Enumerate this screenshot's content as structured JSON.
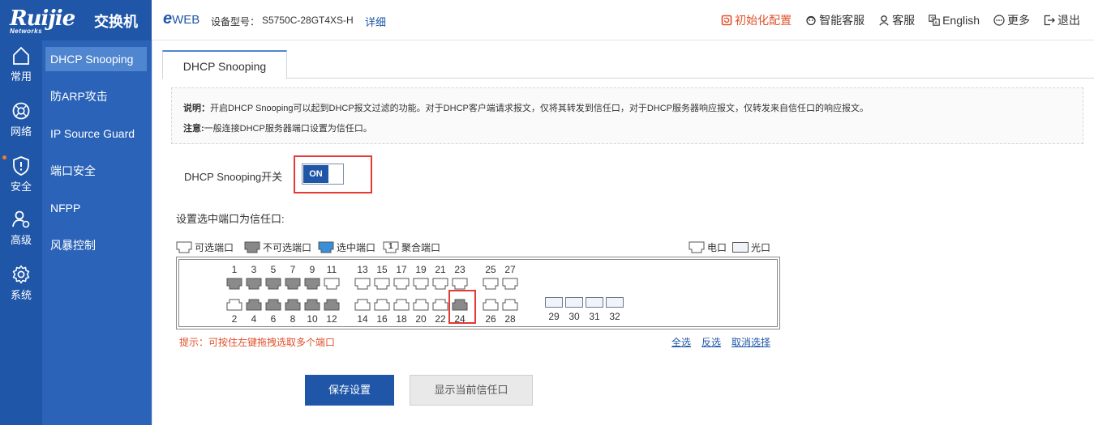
{
  "brand": {
    "logo": "Ruijie",
    "logo_sub": "Networks",
    "product": "交换机"
  },
  "topbar": {
    "eweb_e": "e",
    "eweb_rest": "WEB",
    "device_label": "设备型号：",
    "device_model": "S5750C-28GT4XS-H",
    "detail": "详细",
    "actions": [
      {
        "label": "初始化配置",
        "icon": "reset-icon",
        "color": "#e0502a"
      },
      {
        "label": "智能客服",
        "icon": "smart-service-icon"
      },
      {
        "label": "客服",
        "icon": "user-service-icon"
      },
      {
        "label": "English",
        "icon": "language-icon"
      },
      {
        "label": "更多",
        "icon": "more-icon"
      },
      {
        "label": "退出",
        "icon": "logout-icon"
      }
    ]
  },
  "sidebar": {
    "items": [
      {
        "label": "常用",
        "icon": "home-icon"
      },
      {
        "label": "网络",
        "icon": "globe-icon"
      },
      {
        "label": "安全",
        "icon": "shield-icon",
        "active": true
      },
      {
        "label": "高级",
        "icon": "advanced-user-icon"
      },
      {
        "label": "系统",
        "icon": "gear-icon"
      }
    ]
  },
  "submenu": {
    "items": [
      "DHCP Snooping",
      "防ARP攻击",
      "IP Source Guard",
      "端口安全",
      "NFPP",
      "风暴控制"
    ]
  },
  "tab": {
    "label": "DHCP Snooping"
  },
  "note": {
    "label1": "说明：",
    "text1": "开启DHCP Snooping可以起到DHCP报文过滤的功能。对于DHCP客户端请求报文，仅将其转发到信任口，对于DHCP服务器响应报文，仅转发来自信任口的响应报文。",
    "label2": "注意:",
    "text2": "一般连接DHCP服务器端口设置为信任口。"
  },
  "switch": {
    "label": "DHCP Snooping开关",
    "state": "ON"
  },
  "trust_label": "设置选中端口为信任口:",
  "legend": {
    "available": "可选端口",
    "unavailable": "不可选端口",
    "selected": "选中端口",
    "agg_num": "1",
    "aggregate": "聚合端口",
    "copper": "电口",
    "fiber": "光口"
  },
  "ports": {
    "top_row": [
      {
        "num": "1",
        "state": "unavailable"
      },
      {
        "num": "3",
        "state": "unavailable"
      },
      {
        "num": "5",
        "state": "unavailable"
      },
      {
        "num": "7",
        "state": "unavailable"
      },
      {
        "num": "9",
        "state": "unavailable"
      },
      {
        "num": "11",
        "state": "available"
      },
      {
        "num": "13",
        "state": "available"
      },
      {
        "num": "15",
        "state": "available"
      },
      {
        "num": "17",
        "state": "available"
      },
      {
        "num": "19",
        "state": "available"
      },
      {
        "num": "21",
        "state": "available"
      },
      {
        "num": "23",
        "state": "available"
      },
      {
        "num": "25",
        "state": "available"
      },
      {
        "num": "27",
        "state": "available"
      }
    ],
    "bottom_row": [
      {
        "num": "2",
        "state": "available"
      },
      {
        "num": "4",
        "state": "unavailable"
      },
      {
        "num": "6",
        "state": "unavailable"
      },
      {
        "num": "8",
        "state": "unavailable"
      },
      {
        "num": "10",
        "state": "unavailable"
      },
      {
        "num": "12",
        "state": "unavailable"
      },
      {
        "num": "14",
        "state": "available"
      },
      {
        "num": "16",
        "state": "available"
      },
      {
        "num": "18",
        "state": "available"
      },
      {
        "num": "20",
        "state": "available"
      },
      {
        "num": "22",
        "state": "available"
      },
      {
        "num": "24",
        "state": "unavailable"
      },
      {
        "num": "26",
        "state": "available"
      },
      {
        "num": "28",
        "state": "available"
      }
    ],
    "fiber": [
      "29",
      "30",
      "31",
      "32"
    ]
  },
  "hint": "提示：可按住左键拖拽选取多个端口",
  "links": {
    "select_all": "全选",
    "invert": "反选",
    "clear": "取消选择"
  },
  "buttons": {
    "save": "保存设置",
    "show_trust": "显示当前信任口"
  },
  "colors": {
    "brand": "#1f56a8",
    "accent": "#e0502a",
    "highlight": "#e53935"
  }
}
